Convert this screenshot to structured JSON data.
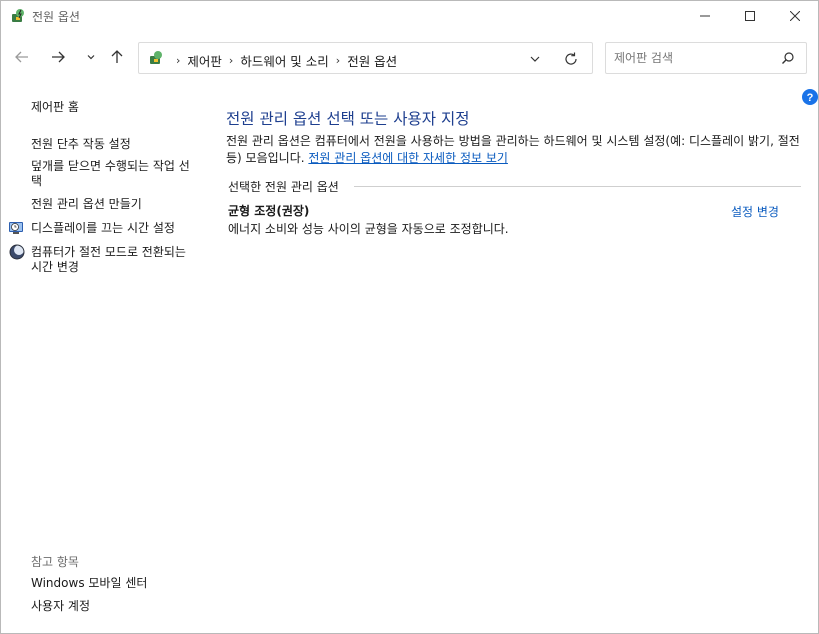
{
  "window": {
    "title": "전원 옵션",
    "icons": [
      "power-options-icon",
      "minimize-icon",
      "maximize-icon",
      "close-icon"
    ]
  },
  "nav": {
    "breadcrumbs": [
      "제어판",
      "하드웨어 및 소리",
      "전원 옵션"
    ],
    "search_placeholder": "제어판 검색",
    "icons": [
      "back-arrow-icon",
      "forward-arrow-icon",
      "recent-dropdown-icon",
      "up-arrow-icon",
      "control-panel-icon",
      "chevron-down-icon",
      "refresh-icon",
      "search-icon"
    ]
  },
  "left_pane": {
    "home": "제어판 홈",
    "tasks": [
      "전원 단추 작동 설정",
      "덮개를 닫으면 수행되는 작업 선택",
      "전원 관리 옵션 만들기",
      "디스플레이를 끄는 시간 설정",
      "컴퓨터가 절전 모드로 전환되는 시간 변경"
    ],
    "see_also_header": "참고 항목",
    "see_also": [
      "Windows 모바일 센터",
      "사용자 계정"
    ]
  },
  "main": {
    "title": "전원 관리 옵션 선택 또는 사용자 지정",
    "description": "전원 관리 옵션은 컴퓨터에서 전원을 사용하는 방법을 관리하는 하드웨어 및 시스템 설정(예: 디스플레이 밝기, 절전 등) 모음입니다.",
    "description_link": "전원 관리 옵션에 대한 자세한 정보 보기",
    "section_label": "선택한 전원 관리 옵션",
    "plan_name": "균형 조정(권장)",
    "plan_description": "에너지 소비와 성능 사이의 균형을 자동으로 조정합니다.",
    "plan_change": "설정 변경"
  },
  "colors": {
    "title_blue": "#1e3f8f",
    "link_blue": "#0a5bbf",
    "help_blue": "#1a73e8"
  }
}
